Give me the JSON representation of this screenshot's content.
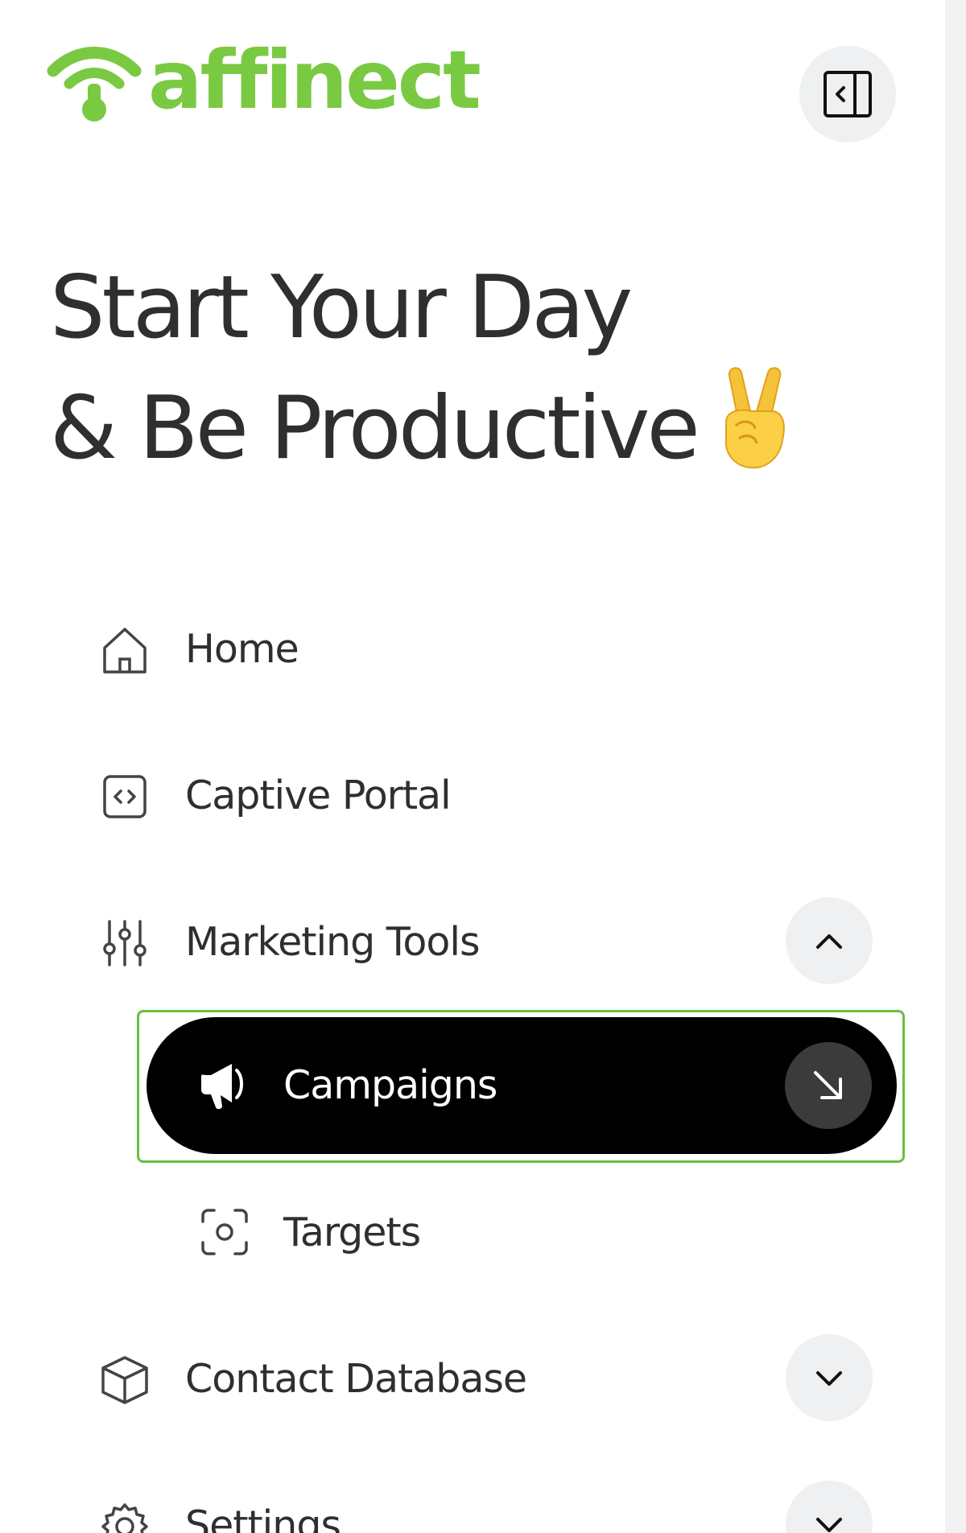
{
  "brand": {
    "name": "affinect",
    "color": "#7ac943"
  },
  "header": {
    "collapse_icon": "sidebar-collapse-icon"
  },
  "headline": {
    "line1": "Start Your Day",
    "line2": "& Be Productive",
    "emoji": "victory-hand"
  },
  "nav": {
    "items": [
      {
        "label": "Home",
        "icon": "home-icon"
      },
      {
        "label": "Captive Portal",
        "icon": "code-window-icon"
      },
      {
        "label": "Marketing Tools",
        "icon": "sliders-icon",
        "expanded": true
      },
      {
        "label": "Contact Database",
        "icon": "cube-icon",
        "expanded": false
      },
      {
        "label": "Settings",
        "icon": "gear-icon",
        "expanded": false
      }
    ],
    "marketing_sub": [
      {
        "label": "Campaigns",
        "icon": "megaphone-icon",
        "active": true
      },
      {
        "label": "Targets",
        "icon": "target-scan-icon",
        "active": false
      }
    ]
  },
  "colors": {
    "active_bg": "#000000",
    "focus_ring": "#6abf3f",
    "text": "#2f2f2f"
  }
}
